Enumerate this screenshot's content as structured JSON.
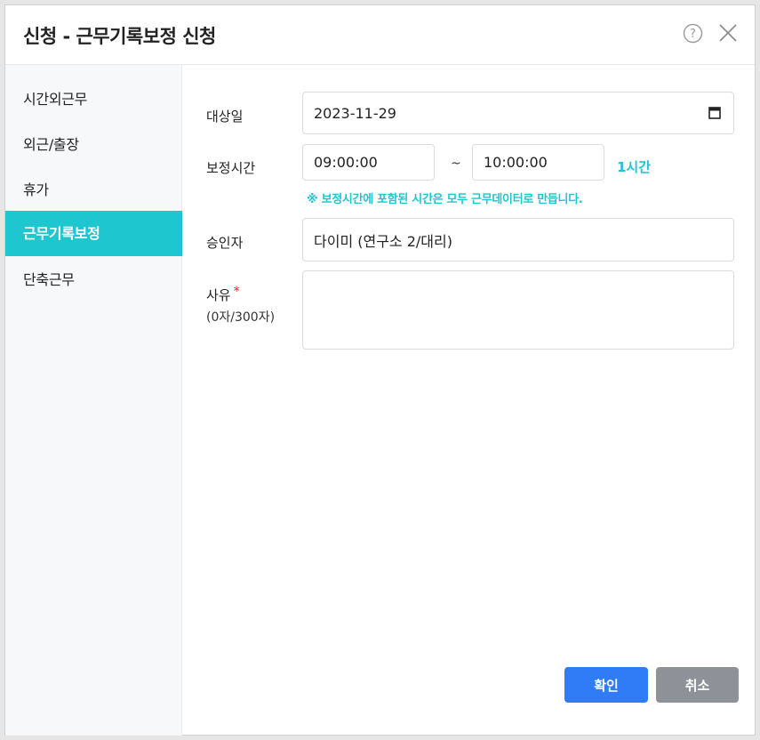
{
  "dialog": {
    "title": "신청 - 근무기록보정 신청",
    "icons": [
      "help-icon",
      "close-icon"
    ]
  },
  "sidebar": {
    "items": [
      {
        "label": "시간외근무",
        "active": false
      },
      {
        "label": "외근/출장",
        "active": false
      },
      {
        "label": "휴가",
        "active": false
      },
      {
        "label": "근무기록보정",
        "active": true
      },
      {
        "label": "단축근무",
        "active": false
      }
    ]
  },
  "form": {
    "target_date_label": "대상일",
    "target_date_value": "2023-11-29",
    "correction_time_label": "보정시간",
    "start_time": "09:00:00",
    "tilde": "~",
    "end_time": "10:00:00",
    "duration": "1시간",
    "notice": "※ 보정시간에 포함된 시간은 모두 근무데이터로 만듭니다.",
    "approver_label": "승인자",
    "approver_value": "다이미 (연구소 2/대리)",
    "reason_label": "사유",
    "reason_required_mark": "*",
    "reason_count": "(0자/300자)",
    "reason_value": ""
  },
  "buttons": {
    "confirm": "확인",
    "cancel": "취소"
  },
  "colors": {
    "accent": "#1ec6cf",
    "primary_button": "#2f7cf6",
    "secondary_button": "#8e9198",
    "required": "#e0242d"
  }
}
